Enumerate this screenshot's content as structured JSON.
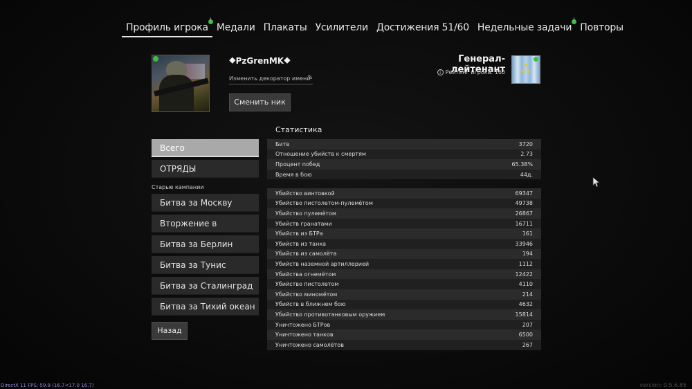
{
  "tabs": [
    {
      "label": "Профиль игрока",
      "active": true,
      "dot": true
    },
    {
      "label": "Медали",
      "active": false,
      "dot": false
    },
    {
      "label": "Плакаты",
      "active": false,
      "dot": false
    },
    {
      "label": "Усилители",
      "active": false,
      "dot": false
    },
    {
      "label": "Достижения 51/60",
      "active": false,
      "dot": false
    },
    {
      "label": "Недельные задачи",
      "active": false,
      "dot": true
    },
    {
      "label": "Повторы",
      "active": false,
      "dot": false
    }
  ],
  "profile": {
    "nickname": "⯁PzGrenMK⯁",
    "decorator_link": "Изменить декоратор имени",
    "change_nick_button": "Сменить ник",
    "rank_title": "Генерал-лейтенант",
    "rating_label": "Рейтинг игрока: 160"
  },
  "menu": {
    "items_top": [
      "Всего",
      "ОТРЯДЫ"
    ],
    "old_campaigns_label": "Старые кампании",
    "campaigns": [
      "Битва за Москву",
      "Вторжение в Нормандию",
      "Битва за Берлин",
      "Битва за Тунис",
      "Битва за Сталинград",
      "Битва за Тихий океан"
    ],
    "back_button": "Назад"
  },
  "stats": {
    "title": "Статистика",
    "general": [
      {
        "label": "Битв",
        "value": "3720"
      },
      {
        "label": "Отношение убийств к смертям",
        "value": "2.73"
      },
      {
        "label": "Процент побед",
        "value": "65.38%"
      },
      {
        "label": "Время в бою",
        "value": "44д."
      }
    ],
    "kills": [
      {
        "label": "Убийство винтовкой",
        "value": "69347"
      },
      {
        "label": "Убийство пистолетом-пулемётом",
        "value": "49738"
      },
      {
        "label": "Убийство пулемётом",
        "value": "26867"
      },
      {
        "label": "Убийств гранатами",
        "value": "16711"
      },
      {
        "label": "Убийств из БТРа",
        "value": "161"
      },
      {
        "label": "Убийств из танка",
        "value": "33946"
      },
      {
        "label": "Убийств из самолёта",
        "value": "194"
      },
      {
        "label": "Убийств наземной артиллерией",
        "value": "1112"
      },
      {
        "label": "Убийства огнемётом",
        "value": "12422"
      },
      {
        "label": "Убийство пистолетом",
        "value": "4110"
      },
      {
        "label": "Убийство миномётом",
        "value": "214"
      },
      {
        "label": "Убийств в ближнем бою",
        "value": "4632"
      },
      {
        "label": "Убийство противотанковым оружием",
        "value": "15814"
      },
      {
        "label": "Уничтожено БТРов",
        "value": "207"
      },
      {
        "label": "Уничтожено танков",
        "value": "6500"
      },
      {
        "label": "Уничтожено самолётов",
        "value": "267"
      }
    ]
  },
  "footer": {
    "debug": "DirectX 11 FPS: 59.9 (16.7<17.0 16.7)",
    "version": "version: 0.5.6.85"
  }
}
